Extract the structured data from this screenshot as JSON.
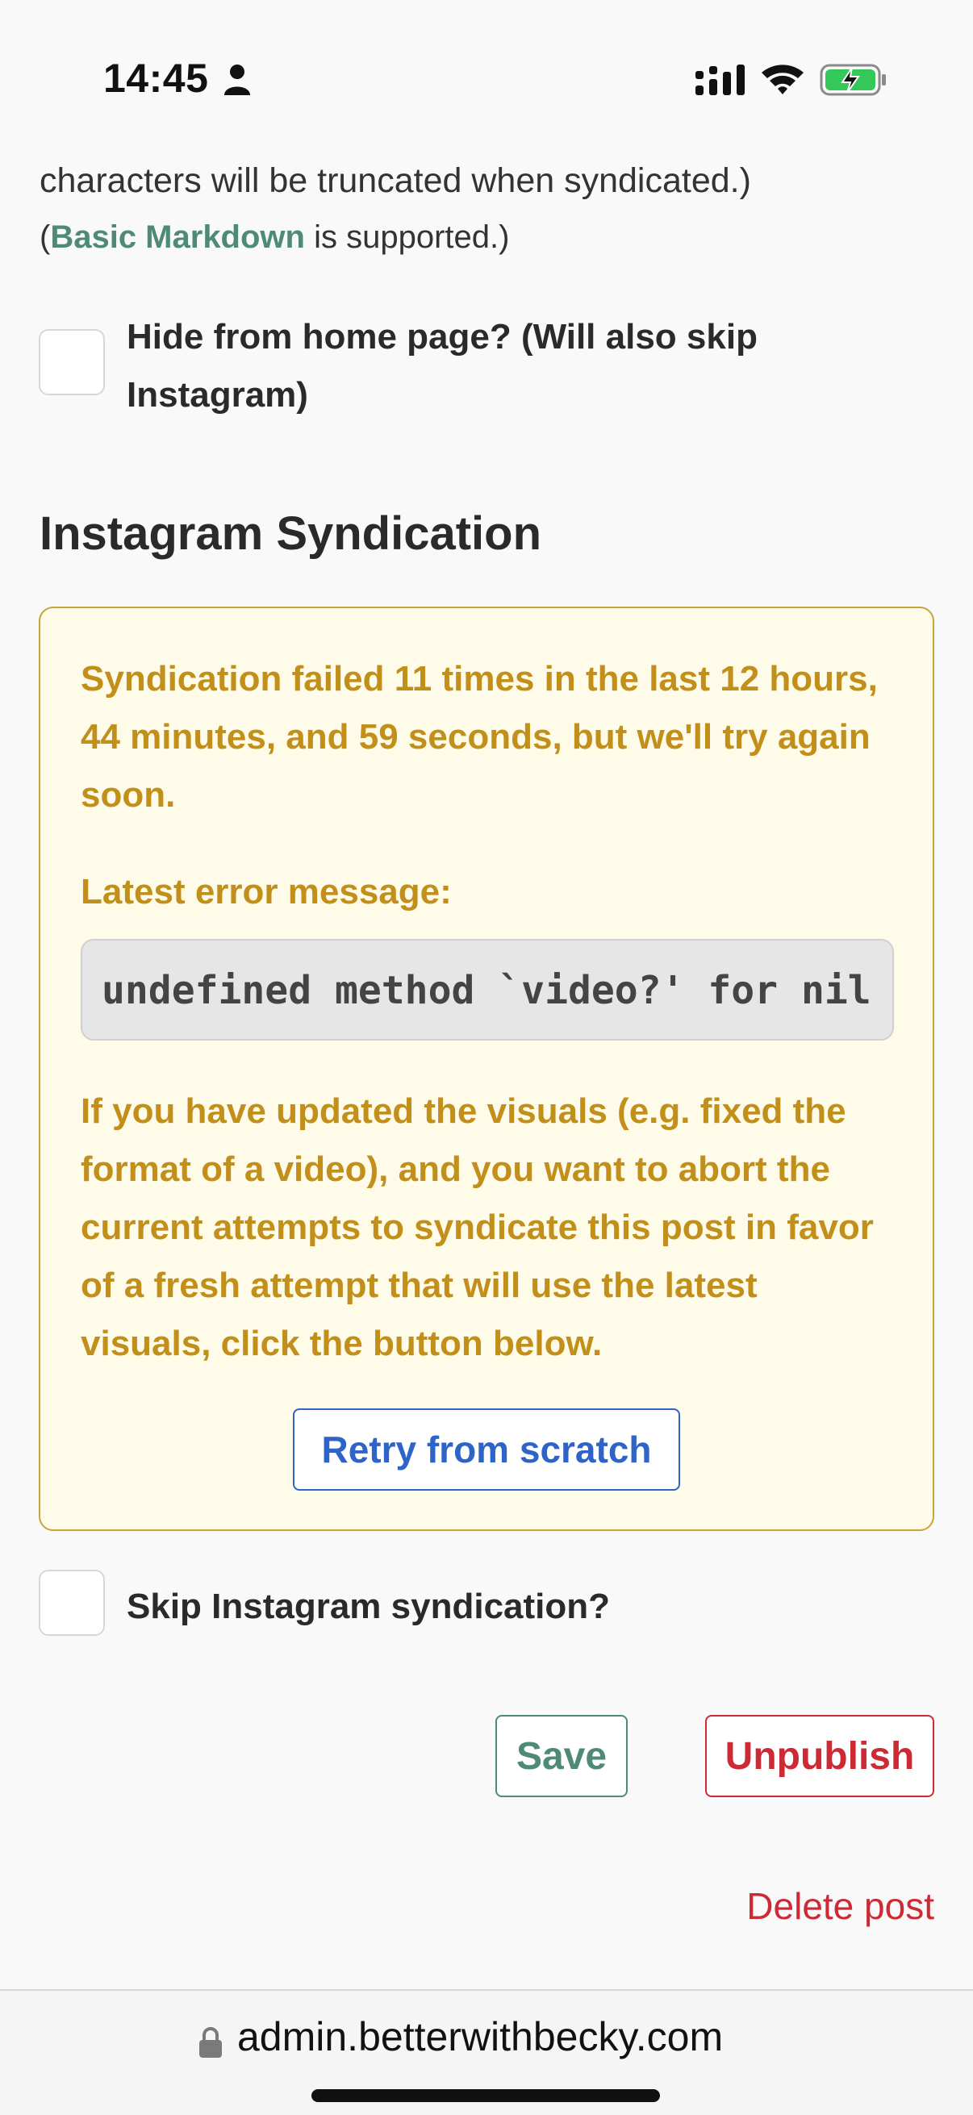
{
  "status_bar": {
    "time": "14:45"
  },
  "form": {
    "truncate_note": "characters will be truncated when syndicated.)",
    "markdown_open": "(",
    "markdown_link": "Basic Markdown",
    "markdown_rest": " is supported.)",
    "hide_home_label_line1": "Hide from home page? (Will also skip",
    "hide_home_label_line2": "Instagram)",
    "hide_home_checked": false
  },
  "instagram": {
    "heading": "Instagram Syndication",
    "failure_message": "Syndication failed 11 times in the last 12 hours, 44 minutes, and 59 seconds, but we'll try again soon.",
    "latest_error_label": "Latest error message:",
    "error_code": "undefined method `video?' for nil",
    "instructions": "If you have updated the visuals (e.g. fixed the format of a video), and you want to abort the current attempts to syndicate this post in favor of a fresh attempt that will use the latest visuals, click the button below.",
    "retry_label": "Retry from scratch",
    "skip_label": "Skip Instagram syndication?",
    "skip_checked": false
  },
  "actions": {
    "save_label": "Save",
    "unpublish_label": "Unpublish",
    "delete_label": "Delete post"
  },
  "browser": {
    "url": "admin.betterwithbecky.com"
  },
  "colors": {
    "accent_green": "#4f8a79",
    "warning_text": "#c18f1a",
    "warning_bg": "#fefbe9",
    "danger_red": "#cc2b36",
    "link_blue": "#2e63c7"
  }
}
